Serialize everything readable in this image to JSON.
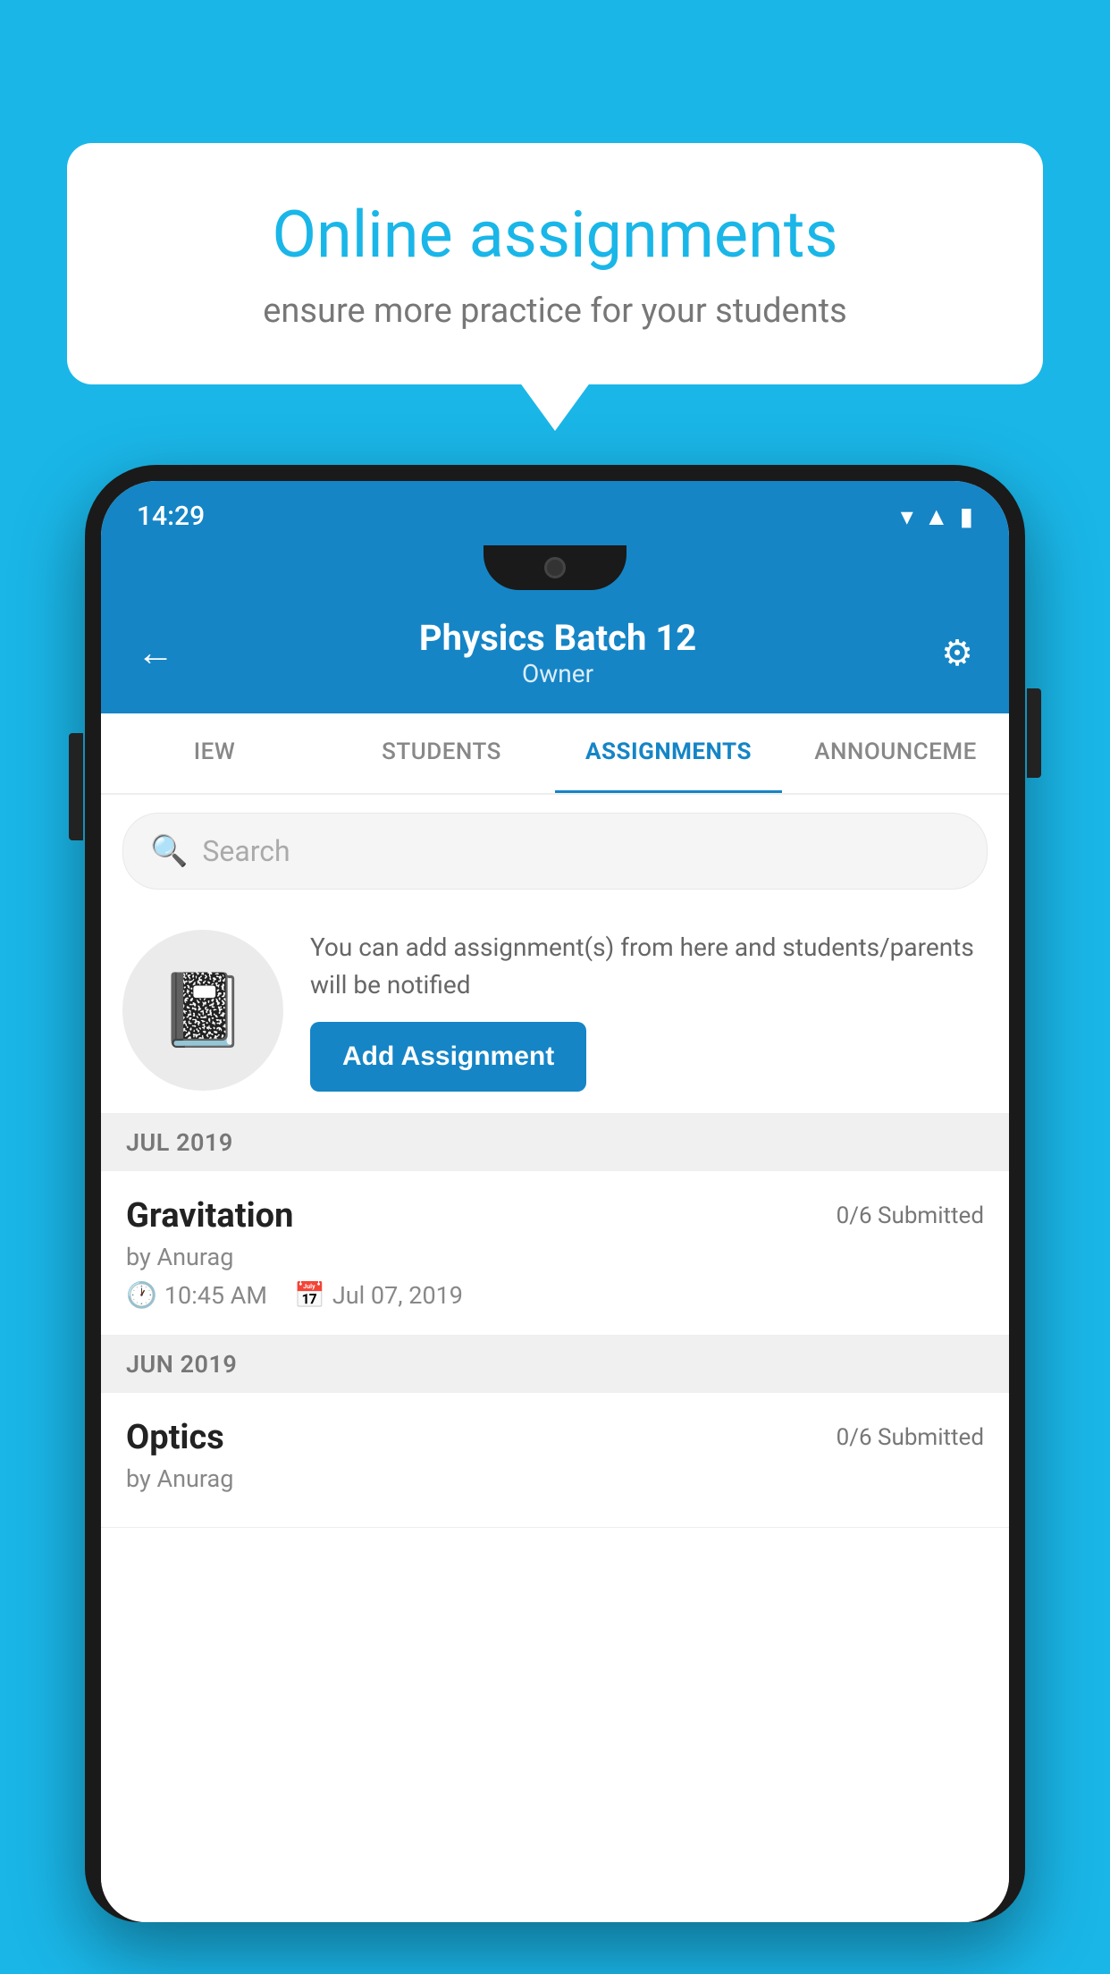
{
  "background_color": "#1ab6e8",
  "bubble": {
    "title": "Online assignments",
    "subtitle": "ensure more practice for your students"
  },
  "phone": {
    "status_bar": {
      "time": "14:29",
      "icons": [
        "wifi",
        "signal",
        "battery"
      ]
    },
    "header": {
      "title": "Physics Batch 12",
      "subtitle": "Owner",
      "back_label": "←",
      "settings_label": "⚙"
    },
    "tabs": [
      {
        "label": "IEW",
        "active": false
      },
      {
        "label": "STUDENTS",
        "active": false
      },
      {
        "label": "ASSIGNMENTS",
        "active": true
      },
      {
        "label": "ANNOUNCEME",
        "active": false
      }
    ],
    "search": {
      "placeholder": "Search"
    },
    "promo": {
      "text": "You can add assignment(s) from here and students/parents will be notified",
      "button_label": "Add Assignment"
    },
    "sections": [
      {
        "month_label": "JUL 2019",
        "assignments": [
          {
            "name": "Gravitation",
            "submitted": "0/6 Submitted",
            "by": "by Anurag",
            "time": "10:45 AM",
            "date": "Jul 07, 2019"
          }
        ]
      },
      {
        "month_label": "JUN 2019",
        "assignments": [
          {
            "name": "Optics",
            "submitted": "0/6 Submitted",
            "by": "by Anurag",
            "time": "",
            "date": ""
          }
        ]
      }
    ]
  }
}
